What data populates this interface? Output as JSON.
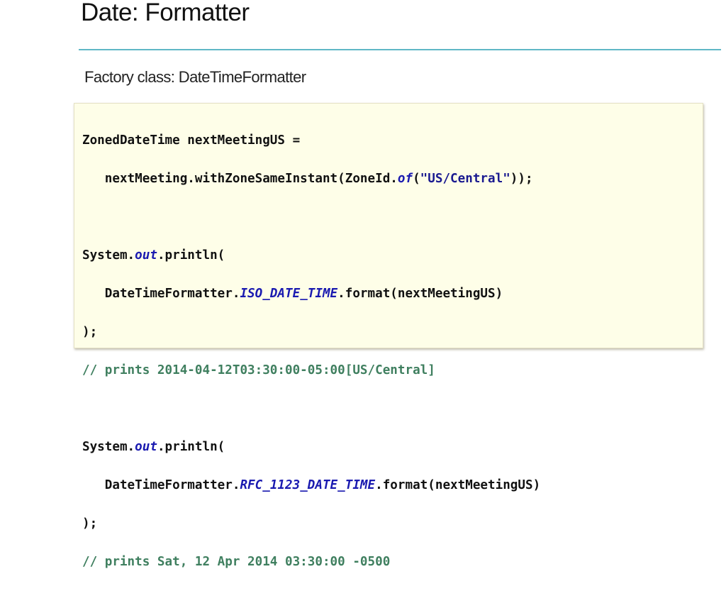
{
  "slide": {
    "title": "Date: Formatter",
    "subtitle": "Factory class: DateTimeFormatter",
    "accent_color": "#5fb7c6",
    "code_background": "#fefee8"
  },
  "code": {
    "l1": "ZonedDateTime nextMeetingUS =",
    "l2a": "   nextMeeting.withZoneSameInstant(ZoneId.",
    "l2b": "of",
    "l2c": "(",
    "l2d": "\"US/Central\"",
    "l2e": "));",
    "l4a": "System.",
    "l4b": "out",
    "l4c": ".println(",
    "l5a": "   DateTimeFormatter.",
    "l5b": "ISO_DATE_TIME",
    "l5c": ".format(nextMeetingUS)",
    "l6": ");",
    "l7": "// prints 2014-04-12T03:30:00-05:00[US/Central]",
    "l9a": "System.",
    "l9b": "out",
    "l9c": ".println(",
    "l10a": "   DateTimeFormatter.",
    "l10b": "RFC_1123_DATE_TIME",
    "l10c": ".format(nextMeetingUS)",
    "l11": ");",
    "l12": "// prints Sat, 12 Apr 2014 03:30:00 -0500"
  }
}
